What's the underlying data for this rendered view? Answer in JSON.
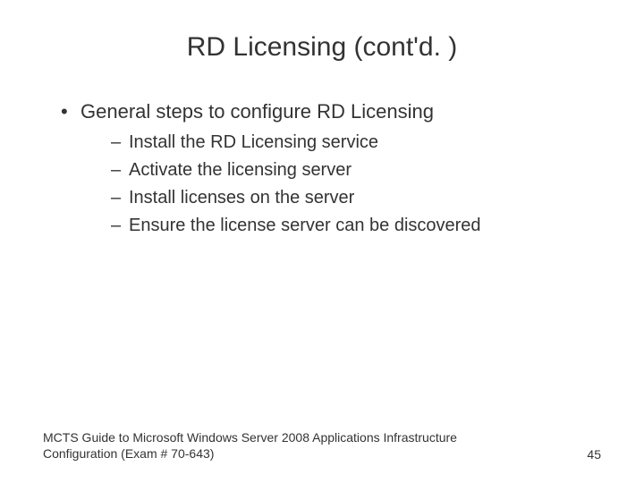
{
  "slide": {
    "title": "RD Licensing (cont'd. )",
    "bullets_level1": [
      "General steps to configure RD Licensing"
    ],
    "bullets_level2": [
      "Install the RD Licensing service",
      "Activate the licensing server",
      "Install licenses on the server",
      "Ensure the license server can be discovered"
    ],
    "footer_text": "MCTS Guide to Microsoft Windows Server 2008 Applications Infrastructure Configuration (Exam # 70-643)",
    "page_number": "45"
  }
}
